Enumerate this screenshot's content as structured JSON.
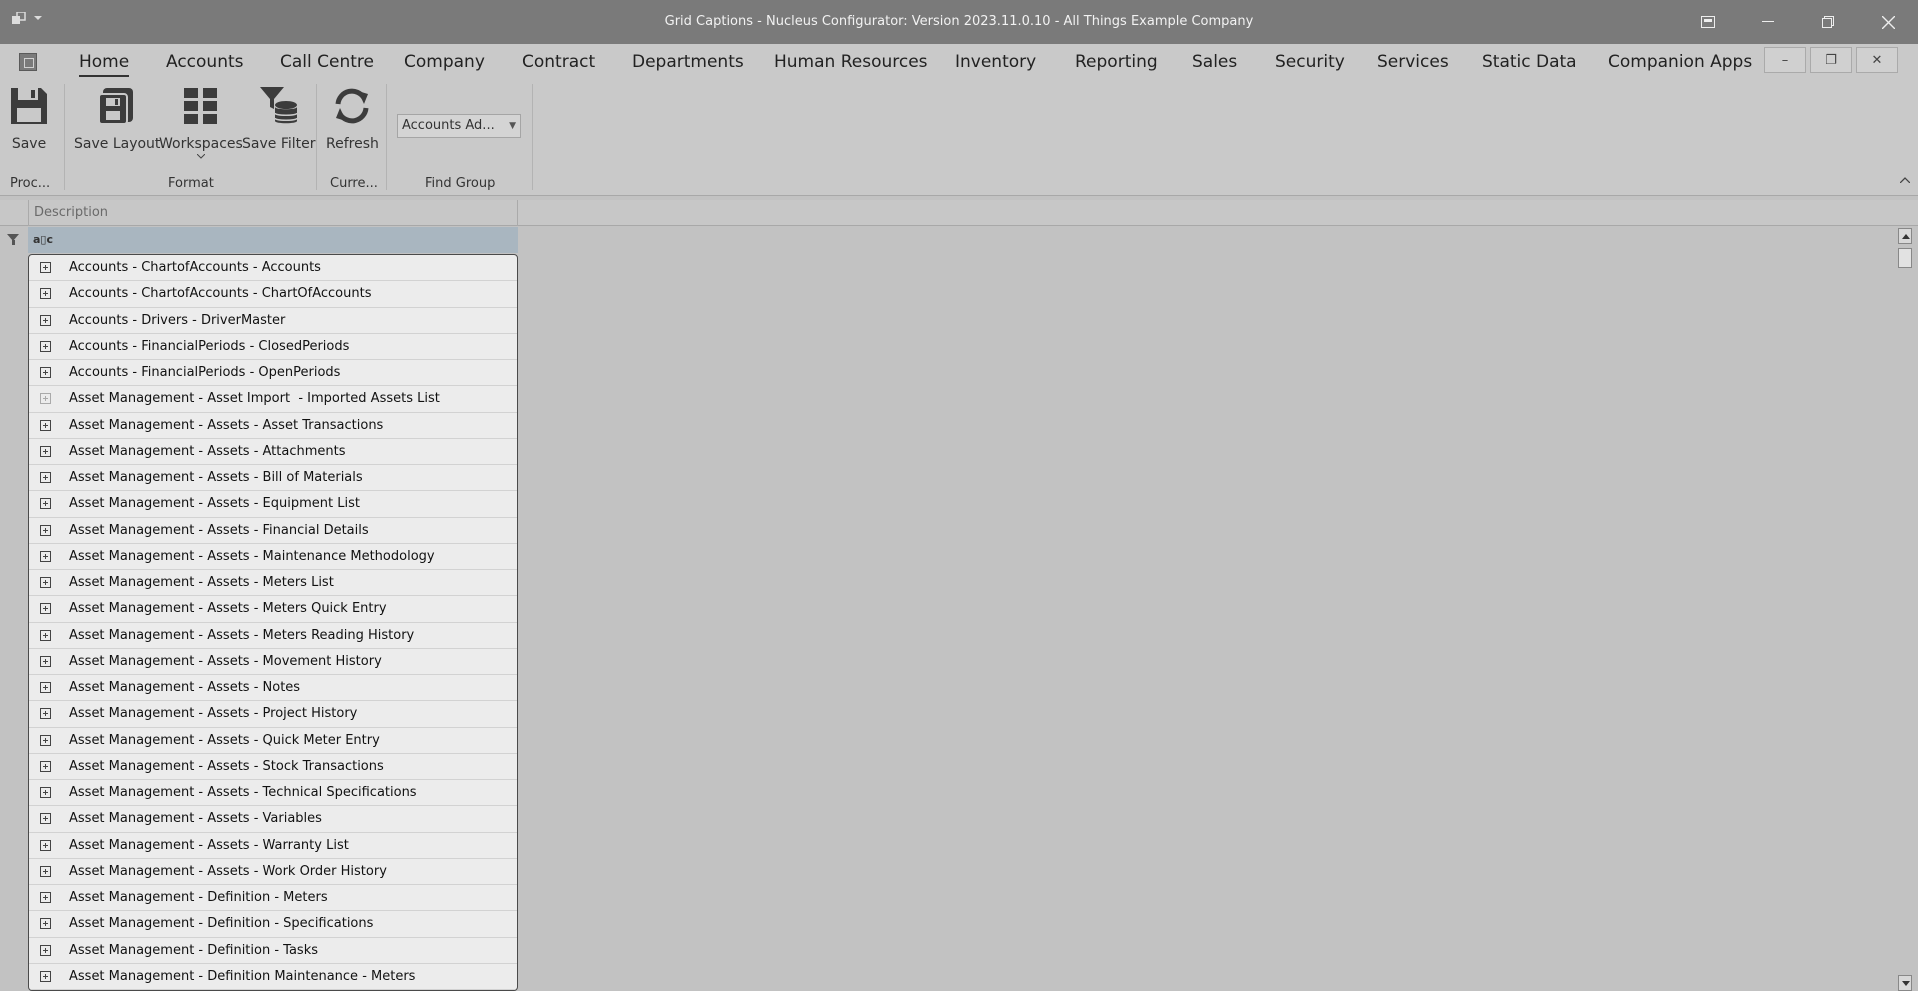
{
  "window": {
    "title": "Grid Captions - Nucleus Configurator: Version 2023.11.0.10 - All Things Example Company"
  },
  "menu": {
    "items": [
      "Home",
      "Accounts",
      "Call Centre",
      "Company",
      "Contract",
      "Departments",
      "Human Resources",
      "Inventory",
      "Reporting",
      "Sales",
      "Security",
      "Services",
      "Static Data",
      "Companion Apps"
    ],
    "active": "Home"
  },
  "ribbon": {
    "save": "Save",
    "save_layout": "Save Layout",
    "workspaces": "Workspaces",
    "save_filter": "Save Filter",
    "refresh": "Refresh",
    "find_group_value": "Accounts Ad...",
    "groups": {
      "process": "Proc...",
      "format": "Format",
      "current": "Curre...",
      "find_group": "Find Group"
    }
  },
  "grid": {
    "column_header": "Description",
    "filter_text": "a▯c",
    "rows": [
      "Accounts - ChartofAccounts - Accounts",
      "Accounts - ChartofAccounts - ChartOfAccounts",
      "Accounts - Drivers - DriverMaster",
      "Accounts - FinancialPeriods - ClosedPeriods",
      "Accounts - FinancialPeriods - OpenPeriods",
      "Asset Management - Asset Import  - Imported Assets List",
      "Asset Management - Assets - Asset Transactions",
      "Asset Management - Assets - Attachments",
      "Asset Management - Assets - Bill of Materials",
      "Asset Management - Assets - Equipment List",
      "Asset Management - Assets - Financial Details",
      "Asset Management - Assets - Maintenance Methodology",
      "Asset Management - Assets - Meters List",
      "Asset Management - Assets - Meters Quick Entry",
      "Asset Management - Assets - Meters Reading History",
      "Asset Management - Assets - Movement History",
      "Asset Management - Assets - Notes",
      "Asset Management - Assets - Project History",
      "Asset Management - Assets - Quick Meter Entry",
      "Asset Management - Assets - Stock Transactions",
      "Asset Management - Assets - Technical Specifications",
      "Asset Management - Assets - Variables",
      "Asset Management - Assets - Warranty List",
      "Asset Management - Assets - Work Order History",
      "Asset Management - Definition - Meters",
      "Asset Management - Definition - Specifications",
      "Asset Management - Definition - Tasks",
      "Asset Management - Definition Maintenance - Meters"
    ]
  }
}
